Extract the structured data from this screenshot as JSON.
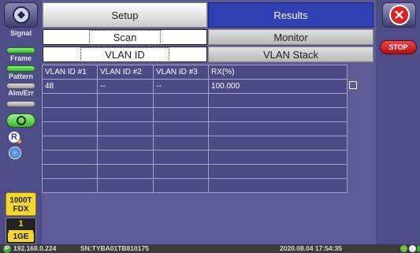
{
  "sidebar": {
    "home_icon": "home-icon",
    "signal_label": "Signal",
    "frame_label": "Frame",
    "pattern_label": "Pattern",
    "alm_err_label": "Alm/Err",
    "speed_badge": {
      "line1": "1000T",
      "line2": "FDX"
    },
    "port": {
      "number": "1",
      "label": "1GE"
    }
  },
  "rightbar": {
    "close_icon": "close-icon",
    "stop_label": "STOP"
  },
  "tabs": {
    "setup": "Setup",
    "results": "Results",
    "scan": "Scan",
    "monitor": "Monitor",
    "vlan_id": "VLAN ID",
    "vlan_stack": "VLAN Stack"
  },
  "table": {
    "headers": [
      "VLAN ID #1",
      "VLAN ID #2",
      "VLAN ID #3",
      "RX(%)"
    ],
    "rows": [
      [
        "48",
        "--",
        "--",
        "100.000"
      ]
    ]
  },
  "statusbar": {
    "ip": "192.168.0.224",
    "serial": "SN:TYBA01TB810175",
    "datetime": "2020.08.04 17:54:35"
  },
  "colors": {
    "background": "#5c5c96",
    "results_tab": "#2f3fb2",
    "stop": "#e02020",
    "speed_badge": "#f4d72a"
  }
}
